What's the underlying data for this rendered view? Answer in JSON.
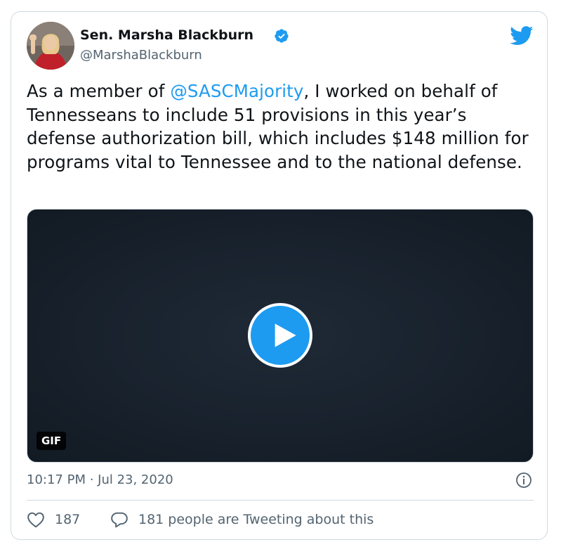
{
  "author": {
    "name": "Sen. Marsha Blackburn",
    "handle": "@MarshaBlackburn",
    "verified": true
  },
  "tweet": {
    "text_before": "As a member of ",
    "mention": "@SASCMajority",
    "text_after": ", I worked on behalf of Tennesseans to include 51 provisions in this year’s defense authorization bill, which includes $148 million for programs vital to Tennessee and to the national defense."
  },
  "media": {
    "badge": "GIF",
    "play_icon": "play-icon"
  },
  "footer": {
    "timestamp": "10:17 PM · Jul 23, 2020",
    "likes": "187",
    "conversation": "181 people are Tweeting about this"
  },
  "icons": {
    "brand": "twitter-bird-icon",
    "verified": "verified-badge-icon",
    "info": "info-icon",
    "like": "heart-icon",
    "reply": "speech-bubble-icon"
  },
  "colors": {
    "accent": "#1d9bf0",
    "text": "#0f1419",
    "muted": "#536471",
    "border": "#cfd9de"
  }
}
